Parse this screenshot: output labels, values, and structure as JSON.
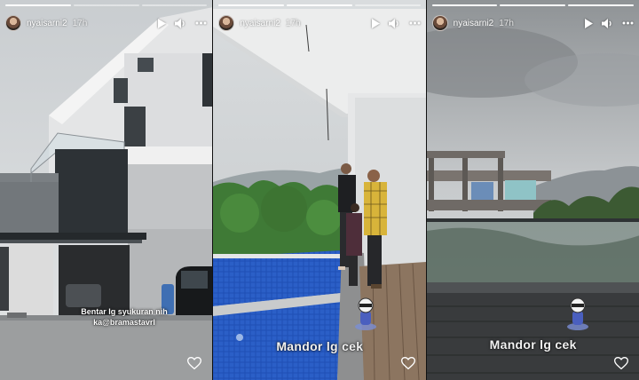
{
  "stories": [
    {
      "username": "nyaisarni2",
      "time": "17h",
      "caption": "Bentar lg syukuran nih ka@bramastavrl"
    },
    {
      "username": "nyaisarni2",
      "time": "17h",
      "caption": "Mandor lg cek"
    },
    {
      "username": "nyaisarni2",
      "time": "17h",
      "caption": "Mandor lg cek"
    }
  ],
  "icons": {
    "play": "play-icon",
    "volume": "volume-icon",
    "more": "more-icon",
    "like": "heart-icon"
  }
}
